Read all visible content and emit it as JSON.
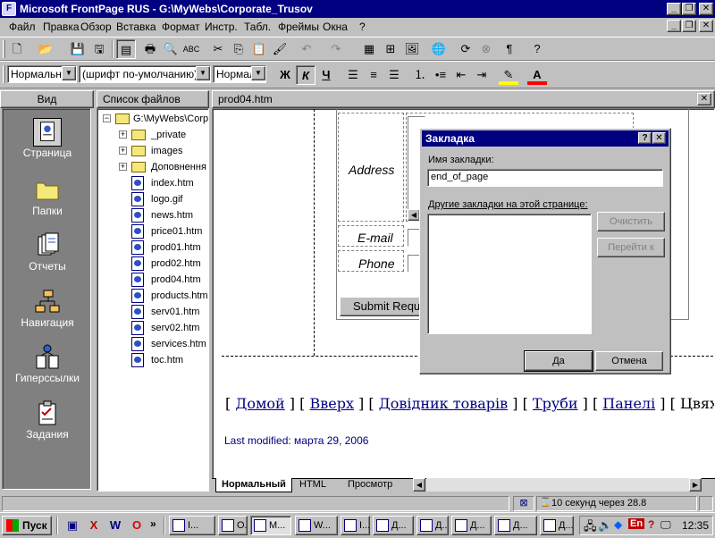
{
  "window": {
    "title": "Microsoft FrontPage RUS - G:\\MyWebs\\Corporate_Trusov"
  },
  "menu": [
    "Файл",
    "Правка",
    "Обзор",
    "Вставка",
    "Формат",
    "Инстр.",
    "Табл.",
    "Фреймы",
    "Окна",
    "?"
  ],
  "format_toolbar": {
    "style": "Нормальный",
    "font": "(шрифт по-умолчанию)",
    "size": "Нормаль"
  },
  "views": {
    "header": "Вид",
    "items": [
      {
        "label": "Страница",
        "icon": "page-view-icon"
      },
      {
        "label": "Папки",
        "icon": "folders-view-icon"
      },
      {
        "label": "Отчеты",
        "icon": "reports-view-icon"
      },
      {
        "label": "Навигация",
        "icon": "navigation-view-icon"
      },
      {
        "label": "Гиперссылки",
        "icon": "hyperlinks-view-icon"
      },
      {
        "label": "Задания",
        "icon": "tasks-view-icon"
      }
    ]
  },
  "filelist": {
    "header": "Список файлов",
    "root": "G:\\MyWebs\\Corp",
    "folders": [
      "_private",
      "images",
      "Доповнення"
    ],
    "files": [
      "index.htm",
      "logo.gif",
      "news.htm",
      "price01.htm",
      "prod01.htm",
      "prod02.htm",
      "prod04.htm",
      "products.htm",
      "serv01.htm",
      "serv02.htm",
      "services.htm",
      "toc.htm"
    ]
  },
  "editor": {
    "tab_title": "prod04.htm",
    "form": {
      "address_label": "Address",
      "email_label": "E-mail",
      "phone_label": "Phone",
      "submit_label": "Submit Requ"
    },
    "nav_links": [
      "Домой",
      "Вверх",
      "Довідник товарів",
      "Труби",
      "Панелі",
      "Цвях"
    ],
    "last_modified": "Last modified: марта 29, 2006"
  },
  "dialog": {
    "title": "Закладка",
    "name_label": "Имя закладки:",
    "name_value": "end_of_page",
    "others_label": "Другие закладки на этой странице:",
    "clear_button": "Очистить",
    "goto_button": "Перейти к",
    "ok_button": "Да",
    "cancel_button": "Отмена"
  },
  "view_tabs": [
    "Нормальный",
    "HTML",
    "Просмотр"
  ],
  "status": {
    "download_time": "10 секунд через 28.8"
  },
  "taskbar": {
    "start": "Пуск",
    "buttons": [
      "I...",
      "O...",
      "M...",
      "W...",
      "I...",
      "Д...",
      "Д...",
      "Д...",
      "Д...",
      "Д..."
    ],
    "tray_lang": "En",
    "clock": "12:35"
  }
}
